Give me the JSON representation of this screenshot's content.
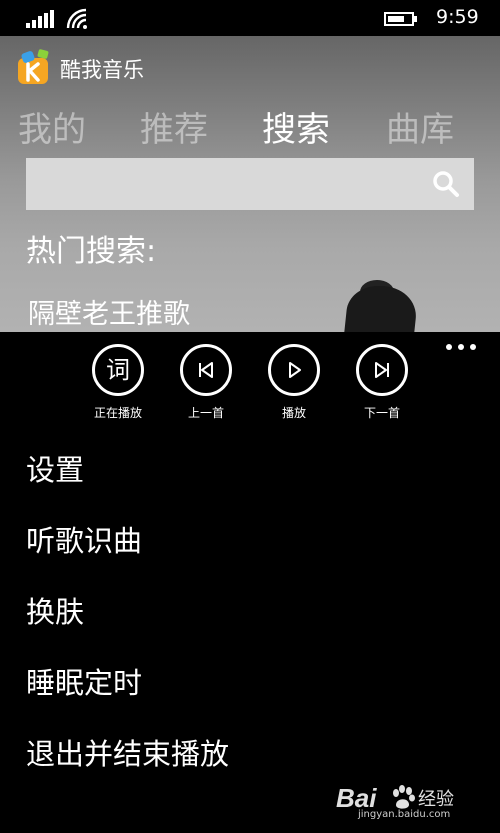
{
  "status_bar": {
    "time": "9:59"
  },
  "app": {
    "title": "酷我音乐"
  },
  "tabs": [
    {
      "label": "我的",
      "active": false
    },
    {
      "label": "推荐",
      "active": false
    },
    {
      "label": "搜索",
      "active": true
    },
    {
      "label": "曲库",
      "active": false
    }
  ],
  "search": {
    "value": "",
    "placeholder": ""
  },
  "hot_search": {
    "label": "热门搜索:",
    "items": [
      "隔壁老王推歌"
    ]
  },
  "app_bar": {
    "buttons": [
      {
        "icon": "lyrics-icon",
        "glyph": "词",
        "label": "正在播放"
      },
      {
        "icon": "previous-icon",
        "label": "上一首"
      },
      {
        "icon": "play-icon",
        "label": "播放"
      },
      {
        "icon": "next-icon",
        "label": "下一首"
      }
    ],
    "menu_items": [
      "设置",
      "听歌识曲",
      "换肤",
      "睡眠定时",
      "退出并结束播放"
    ]
  },
  "watermark": {
    "brand": "Bai",
    "brand_cn": "经验",
    "url": "jingyan.baidu.com"
  },
  "colors": {
    "background": "#000000",
    "search_box": "#d9d9d9",
    "logo_accent": "#f5a623"
  }
}
